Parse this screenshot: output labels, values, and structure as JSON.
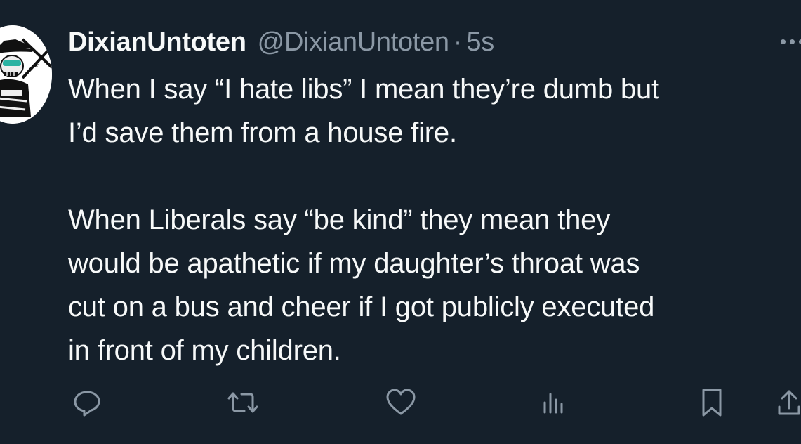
{
  "tweet": {
    "display_name": "DixianUntoten",
    "handle": "@DixianUntoten",
    "separator": "·",
    "time": "5s",
    "paragraphs": [
      [
        "When I say “I hate libs” I mean they’re dumb but",
        "I’d save them from a house fire."
      ],
      [
        "When Liberals say “be kind” they mean they",
        "would be apathetic if my daughter’s throat was",
        "cut on a bus and cheer if I got publicly executed",
        "in front of my children."
      ]
    ]
  },
  "colors": {
    "background": "#15202b",
    "primary_text": "#f7f9f9",
    "secondary_text": "#8b98a5"
  },
  "icons": {
    "more": "more-horizontal-icon",
    "reply": "reply-icon",
    "retweet": "retweet-icon",
    "like": "heart-icon",
    "views": "views-icon",
    "bookmark": "bookmark-icon",
    "share": "share-icon"
  }
}
